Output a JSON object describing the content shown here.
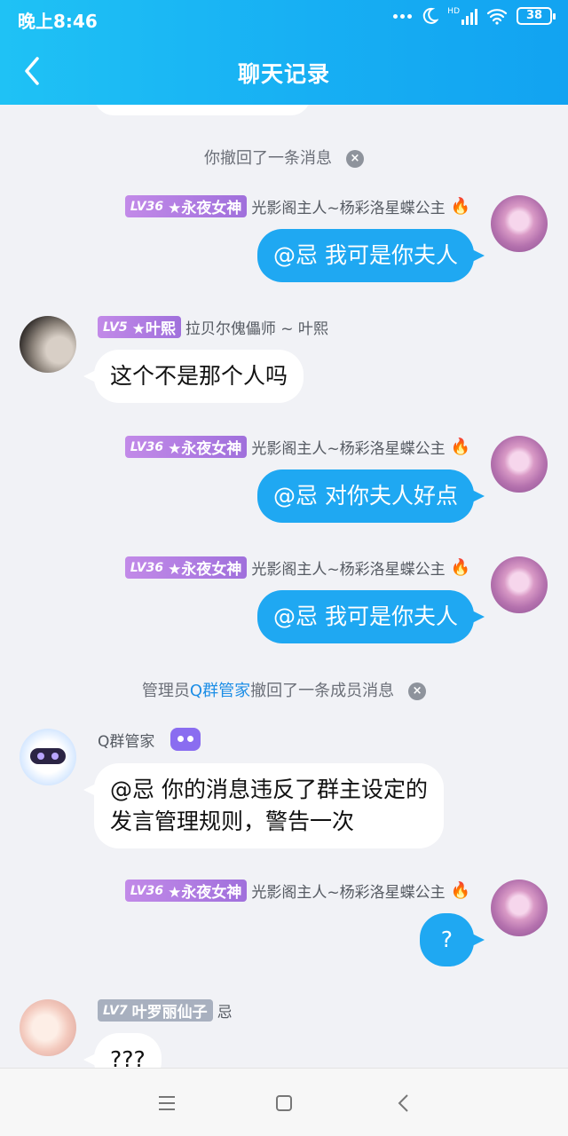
{
  "status_bar": {
    "time": "晚上8:46",
    "signal": "HD",
    "battery": "38"
  },
  "header": {
    "title": "聊天记录"
  },
  "messages": {
    "sys1": {
      "text": "你撤回了一条消息"
    },
    "m1": {
      "level": "LV36",
      "title": "★永夜女神",
      "name": "光影阁主人~杨彩洛星蝶公主",
      "text": "@忌 我可是你夫人"
    },
    "m2": {
      "level": "LV5",
      "title": "★叶熙",
      "name": "拉贝尔傀儡师 ~ 叶熙",
      "text": "这个不是那个人吗"
    },
    "m3": {
      "level": "LV36",
      "title": "★永夜女神",
      "name": "光影阁主人~杨彩洛星蝶公主",
      "text": "@忌 对你夫人好点"
    },
    "m4": {
      "level": "LV36",
      "title": "★永夜女神",
      "name": "光影阁主人~杨彩洛星蝶公主",
      "text": "@忌 我可是你夫人"
    },
    "sys2": {
      "prefix": "管理员",
      "highlight": "Q群管家",
      "suffix": "撤回了一条成员消息"
    },
    "m5": {
      "name": "Q群管家",
      "line1": "@忌 你的消息违反了群主设定的",
      "line2": "发言管理规则，警告一次"
    },
    "m6": {
      "level": "LV36",
      "title": "★永夜女神",
      "name": "光影阁主人~杨彩洛星蝶公主",
      "text": "?"
    },
    "m7": {
      "level": "LV7",
      "title": "叶罗丽仙子",
      "name": "忌",
      "text": "???"
    }
  },
  "colors": {
    "header": "#17aff3",
    "bubble_self": "#1fa8f2",
    "bubble_other": "#ffffff",
    "background": "#f1f2f6"
  }
}
